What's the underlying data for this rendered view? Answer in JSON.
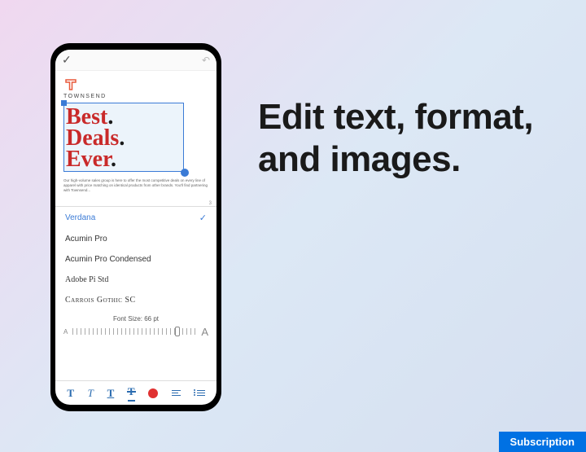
{
  "headline": "Edit text, format, and images.",
  "badge": "Subscription",
  "phone": {
    "logo_text": "TOWNSEND",
    "selected_text": {
      "l1": "Best",
      "l2": "Deals",
      "l3": "Ever"
    },
    "body_text": "Our high-volume sales group is here to offer the most competitive deals on every line of apparel with price matching on identical products from other brands. You'll find partnering with Townsend...",
    "page_indicator": "3",
    "fonts": [
      {
        "name": "Verdana",
        "selected": true
      },
      {
        "name": "Acumin Pro",
        "selected": false
      },
      {
        "name": "Acumin Pro Condensed",
        "selected": false
      },
      {
        "name": "Adobe Pi Std",
        "selected": false
      },
      {
        "name": "Carrois Gothic SC",
        "selected": false
      }
    ],
    "font_size_label": "Font Size: 66 pt",
    "slider": {
      "small": "A",
      "large": "A"
    }
  }
}
